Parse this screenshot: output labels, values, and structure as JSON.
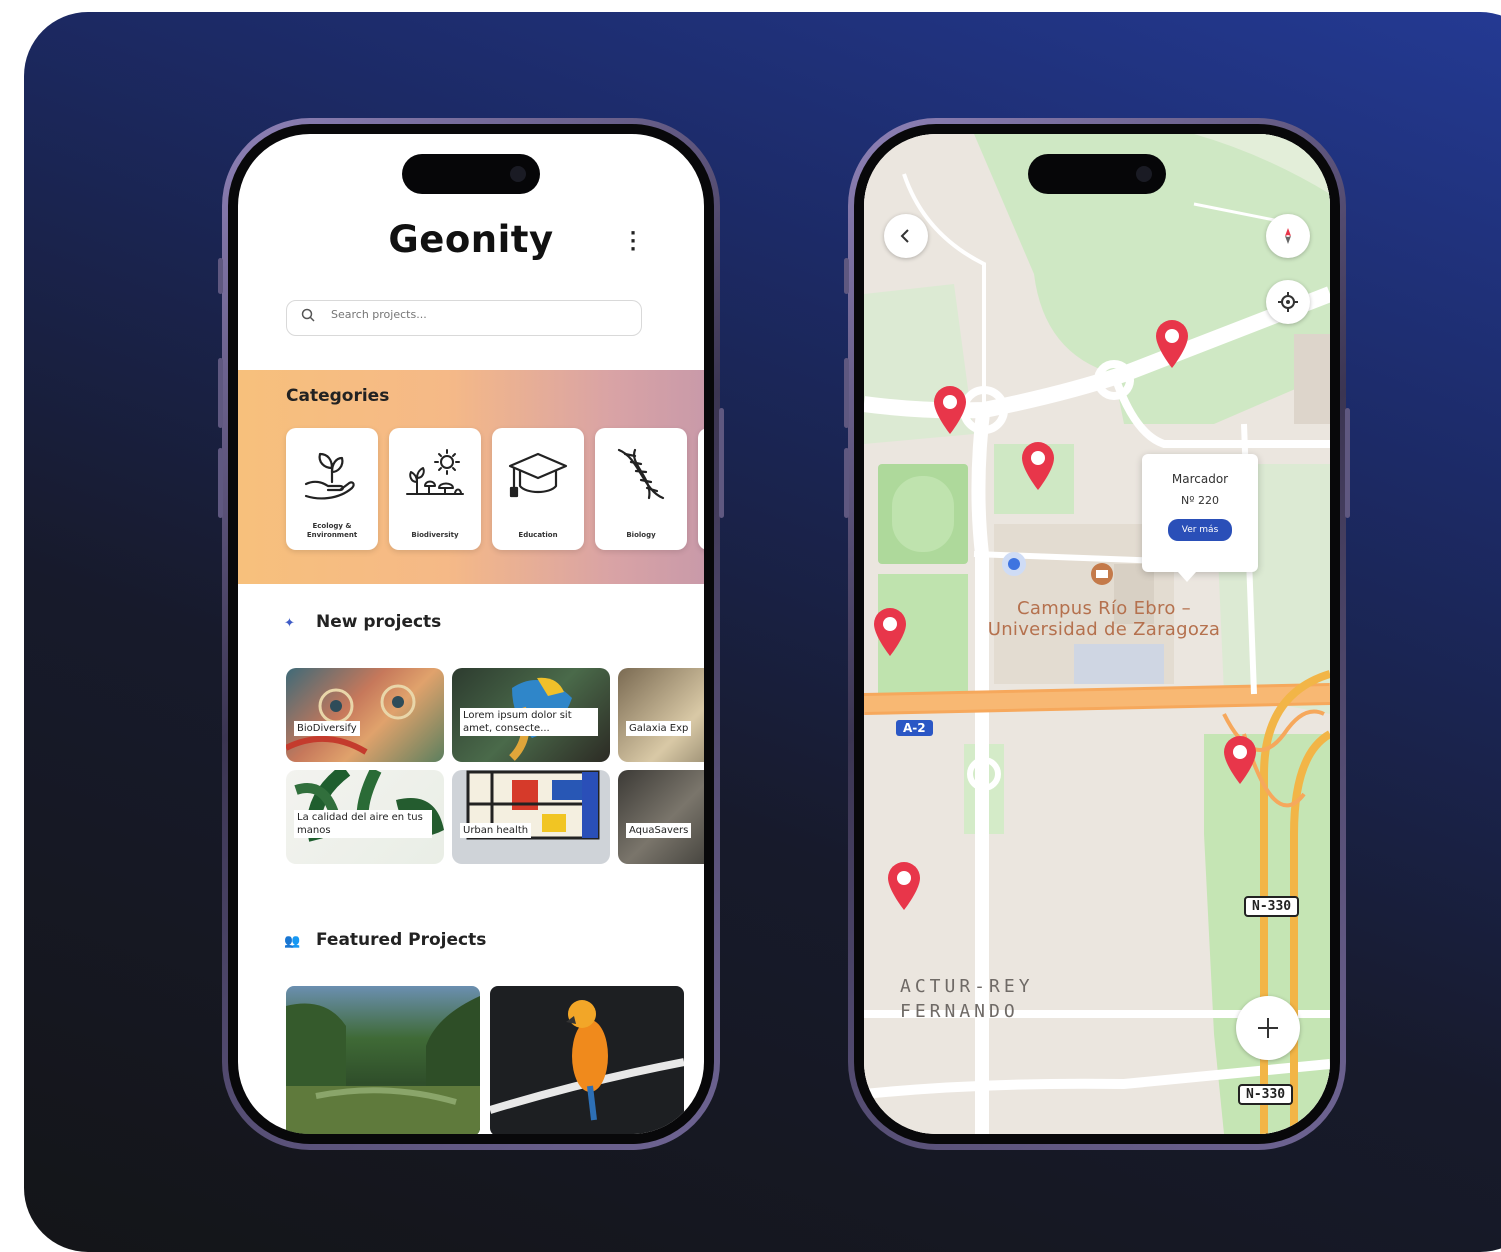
{
  "app": {
    "title": "Geonity",
    "menu_icon": "more-vertical-icon",
    "search_placeholder": "Search projects...",
    "categories_title": "Categories",
    "categories": [
      {
        "label": "Ecology & Environment",
        "icon": "plant-hand-icon"
      },
      {
        "label": "Biodiversity",
        "icon": "biodiversity-icon"
      },
      {
        "label": "Education",
        "icon": "graduation-cap-icon"
      },
      {
        "label": "Biology",
        "icon": "dna-icon"
      }
    ],
    "new_projects_title": "New projects",
    "new_projects": [
      {
        "label": "BioDiversify"
      },
      {
        "label": "Lorem ipsum dolor sit amet, consecte..."
      },
      {
        "label": "Galaxia Exp"
      },
      {
        "label": "La calidad del aire en tus manos"
      },
      {
        "label": "Urban health"
      },
      {
        "label": "AquaSavers"
      }
    ],
    "featured_title": "Featured Projects"
  },
  "map": {
    "popup": {
      "title": "Marcador",
      "number": "Nº 220",
      "button": "Ver más"
    },
    "place_label_line1": "Campus Río Ebro –",
    "place_label_line2": "Universidad de Zaragoza",
    "district_line1": "ACTUR-REY",
    "district_line2": "FERNANDO",
    "road_a2": "A-2",
    "road_n330_top": "N-330",
    "road_n330_bottom": "N-330",
    "back_icon": "chevron-left-icon",
    "compass_icon": "compass-icon",
    "locate_icon": "crosshair-icon",
    "add_icon": "plus-icon",
    "pin_color": "#e8364a",
    "accent": "#2a4fb8"
  },
  "colors": {
    "background_top": "#243a94",
    "background_bottom": "#141518",
    "category_band": "#f5b987"
  }
}
